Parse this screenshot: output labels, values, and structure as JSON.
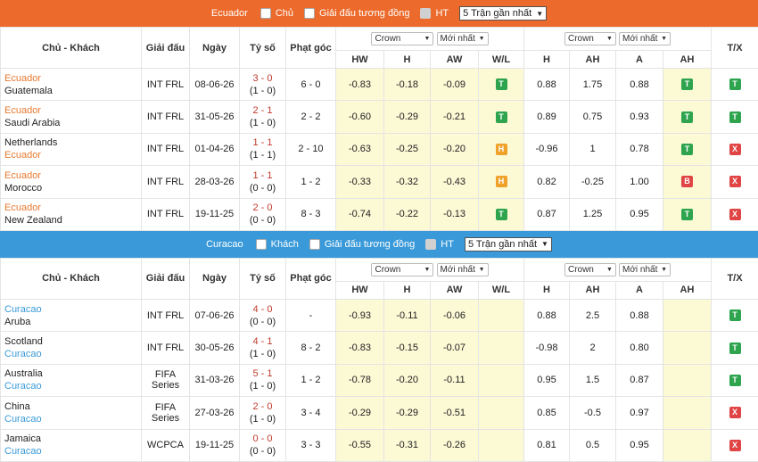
{
  "colors": {
    "block1": "#ec6a2b",
    "block2": "#3a9ad9",
    "home_team1": "#e87a30",
    "home_team2": "#3a9ad9",
    "highlight": "#fcf9d5",
    "win": "#2ea44f",
    "loss": "#e04444",
    "draw": "#f0a12a"
  },
  "columns": {
    "teams": "Chủ - Khách",
    "league": "Giải đấu",
    "date": "Ngày",
    "score": "Tỷ số",
    "corner": "Phạt góc",
    "hw": "HW",
    "h": "H",
    "aw": "AW",
    "wl": "W/L",
    "h2": "H",
    "ah": "AH",
    "a": "A",
    "ah2": "AH",
    "tx": "T/X",
    "crown": "Crown",
    "latest": "Mới nhất"
  },
  "block1": {
    "team": "Ecuador",
    "role": "Chủ",
    "same_league": "Giải đấu tương đồng",
    "ht": "HT",
    "recent": "5 Trận gần nhất",
    "rows": [
      {
        "t1": "Ecuador",
        "t2": "Guatemala",
        "league": "INT FRL",
        "date": "08-06-26",
        "ft": "3 - 0",
        "ht": "(1 - 0)",
        "corner": "6 - 0",
        "hw": "-0.83",
        "h": "-0.18",
        "aw": "-0.09",
        "wl": "T",
        "h2": "0.88",
        "ah": "1.75",
        "a": "0.88",
        "ah2": "T",
        "tx": "T"
      },
      {
        "t1": "Ecuador",
        "t2": "Saudi Arabia",
        "league": "INT FRL",
        "date": "31-05-26",
        "ft": "2 - 1",
        "ht": "(1 - 0)",
        "corner": "2 - 2",
        "hw": "-0.60",
        "h": "-0.29",
        "aw": "-0.21",
        "wl": "T",
        "h2": "0.89",
        "ah": "0.75",
        "a": "0.93",
        "ah2": "T",
        "tx": "T"
      },
      {
        "t1": "Netherlands",
        "t2": "Ecuador",
        "league": "INT FRL",
        "date": "01-04-26",
        "ft": "1 - 1",
        "ht": "(1 - 1)",
        "corner": "2 - 10",
        "hw": "-0.63",
        "h": "-0.25",
        "aw": "-0.20",
        "wl": "H",
        "h2": "-0.96",
        "ah": "1",
        "a": "0.78",
        "ah2": "T",
        "tx": "X"
      },
      {
        "t1": "Ecuador",
        "t2": "Morocco",
        "league": "INT FRL",
        "date": "28-03-26",
        "ft": "1 - 1",
        "ht": "(0 - 0)",
        "corner": "1 - 2",
        "hw": "-0.33",
        "h": "-0.32",
        "aw": "-0.43",
        "wl": "H",
        "h2": "0.82",
        "ah": "-0.25",
        "a": "1.00",
        "ah2": "B",
        "tx": "X"
      },
      {
        "t1": "Ecuador",
        "t2": "New Zealand",
        "league": "INT FRL",
        "date": "19-11-25",
        "ft": "2 - 0",
        "ht": "(0 - 0)",
        "corner": "8 - 3",
        "hw": "-0.74",
        "h": "-0.22",
        "aw": "-0.13",
        "wl": "T",
        "h2": "0.87",
        "ah": "1.25",
        "a": "0.95",
        "ah2": "T",
        "tx": "X"
      }
    ]
  },
  "block2": {
    "team": "Curacao",
    "role": "Khách",
    "same_league": "Giải đấu tương đồng",
    "ht": "HT",
    "recent": "5 Trận gần nhất",
    "rows": [
      {
        "t1": "Curacao",
        "t2": "Aruba",
        "league": "INT FRL",
        "date": "07-06-26",
        "ft": "4 - 0",
        "ht": "(0 - 0)",
        "corner": "-",
        "hw": "-0.93",
        "h": "-0.11",
        "aw": "-0.06",
        "wl": "",
        "h2": "0.88",
        "ah": "2.5",
        "a": "0.88",
        "ah2": "",
        "tx": "T"
      },
      {
        "t1": "Scotland",
        "t2": "Curacao",
        "league": "INT FRL",
        "date": "30-05-26",
        "ft": "4 - 1",
        "ht": "(1 - 0)",
        "corner": "8 - 2",
        "hw": "-0.83",
        "h": "-0.15",
        "aw": "-0.07",
        "wl": "",
        "h2": "-0.98",
        "ah": "2",
        "a": "0.80",
        "ah2": "",
        "tx": "T"
      },
      {
        "t1": "Australia",
        "t2": "Curacao",
        "league": "FIFA Series",
        "date": "31-03-26",
        "ft": "5 - 1",
        "ht": "(1 - 0)",
        "corner": "1 - 2",
        "hw": "-0.78",
        "h": "-0.20",
        "aw": "-0.11",
        "wl": "",
        "h2": "0.95",
        "ah": "1.5",
        "a": "0.87",
        "ah2": "",
        "tx": "T"
      },
      {
        "t1": "China",
        "t2": "Curacao",
        "league": "FIFA Series",
        "date": "27-03-26",
        "ft": "2 - 0",
        "ht": "(1 - 0)",
        "corner": "3 - 4",
        "hw": "-0.29",
        "h": "-0.29",
        "aw": "-0.51",
        "wl": "",
        "h2": "0.85",
        "ah": "-0.5",
        "a": "0.97",
        "ah2": "",
        "tx": "X"
      },
      {
        "t1": "Jamaica",
        "t2": "Curacao",
        "league": "WCPCA",
        "date": "19-11-25",
        "ft": "0 - 0",
        "ht": "(0 - 0)",
        "corner": "3 - 3",
        "hw": "-0.55",
        "h": "-0.31",
        "aw": "-0.26",
        "wl": "",
        "h2": "0.81",
        "ah": "0.5",
        "a": "0.95",
        "ah2": "",
        "tx": "X"
      }
    ]
  }
}
